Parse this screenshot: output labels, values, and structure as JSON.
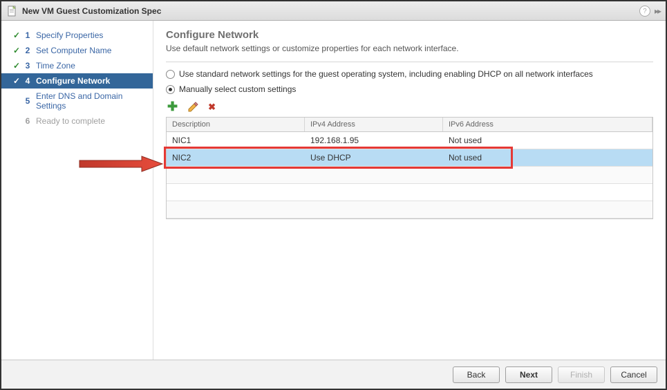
{
  "window": {
    "title": "New VM Guest Customization Spec"
  },
  "sidebar": {
    "steps": [
      {
        "num": "1",
        "label": "Specify Properties",
        "done": true
      },
      {
        "num": "2",
        "label": "Set Computer Name",
        "done": true
      },
      {
        "num": "3",
        "label": "Time Zone",
        "done": true
      },
      {
        "num": "4",
        "label": "Configure Network",
        "done": true,
        "active": true
      },
      {
        "num": "5",
        "label": "Enter DNS and Domain Settings",
        "done": false
      },
      {
        "num": "6",
        "label": "Ready to complete",
        "done": false,
        "disabled": true
      }
    ]
  },
  "main": {
    "heading": "Configure Network",
    "subtitle": "Use default network settings or customize properties for each network interface.",
    "radio_standard": "Use standard network settings for the guest operating system, including enabling DHCP on all network interfaces",
    "radio_manual": "Manually select custom settings",
    "table": {
      "headers": {
        "desc": "Description",
        "v4": "IPv4 Address",
        "v6": "IPv6 Address"
      },
      "rows": [
        {
          "desc": "NIC1",
          "v4": "192.168.1.95",
          "v6": "Not used",
          "selected": false
        },
        {
          "desc": "NIC2",
          "v4": "Use DHCP",
          "v6": "Not used",
          "selected": true
        }
      ]
    }
  },
  "footer": {
    "back": "Back",
    "next": "Next",
    "finish": "Finish",
    "cancel": "Cancel"
  }
}
